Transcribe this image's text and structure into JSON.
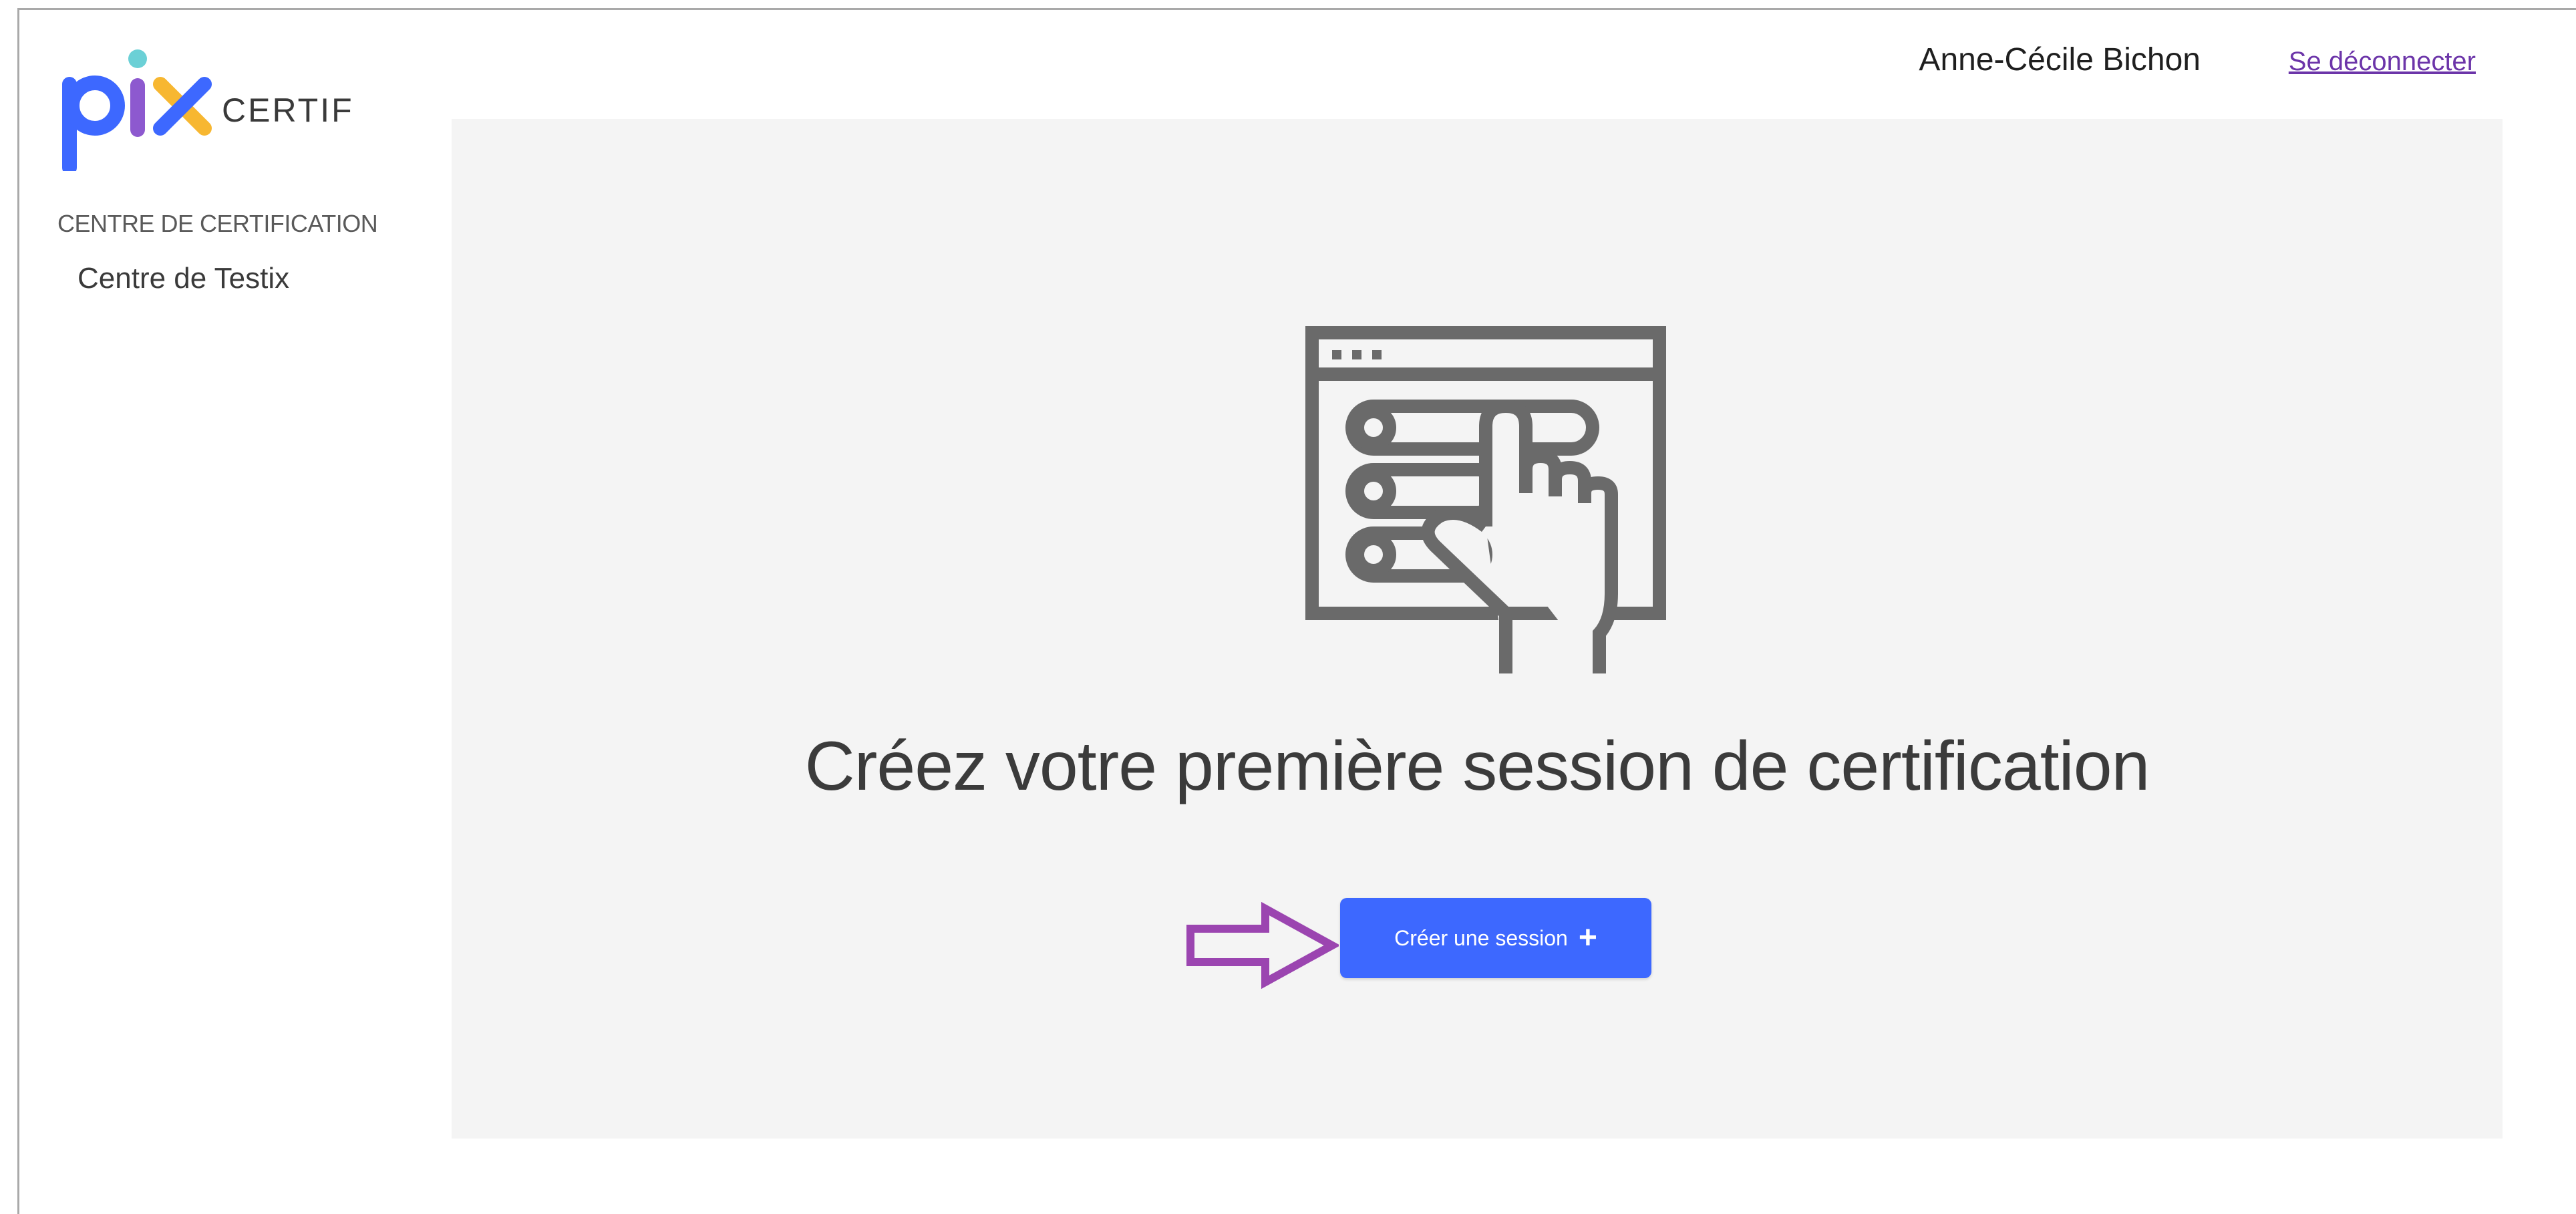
{
  "app": {
    "logo_word": "pix",
    "logo_suffix": "CERTIF",
    "brand_colors": {
      "p": "#3d68ff",
      "i": "#8d59cf",
      "x_dot": "#6bd0d6",
      "x": "#f7b731",
      "accent_button": "#3d68ff",
      "link": "#6c35a9",
      "annotation_arrow": "#9b45b0"
    }
  },
  "sidebar": {
    "section_label": "CENTRE DE CERTIFICATION",
    "centre_name": "Centre de Testix"
  },
  "header": {
    "user_name": "Anne-Cécile Bichon",
    "logout_label": "Se déconnecter"
  },
  "main": {
    "illustration_icon": "touch-list-icon",
    "empty_state_title": "Créez votre première session de certification",
    "create_button_label": "Créer une session",
    "create_button_icon": "plus-icon",
    "create_button_icon_glyph": "+",
    "annotation_icon": "arrow-right-outline-icon"
  }
}
